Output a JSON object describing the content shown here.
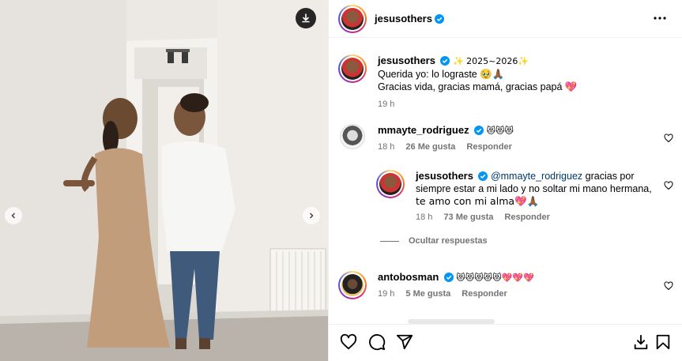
{
  "post": {
    "author": "jesusothers",
    "verified": true
  },
  "caption": {
    "username": "jesusothers",
    "line1": "✨ 2025~2026✨",
    "line2": "Querida yo: lo lograste 🥹🙏🏾",
    "line3": "Gracias vida, gracias mamá, gracias papá 💖",
    "time": "19 h"
  },
  "comments": [
    {
      "username": "mmayte_rodriguez",
      "text": "😻😻😻",
      "time": "18 h",
      "likes": "26 Me gusta",
      "reply_label": "Responder"
    },
    {
      "username": "jesusothers",
      "mention": "@mmayte_rodriguez",
      "text_line1": " gracias por",
      "text_line2": "siempre estar a mi lado y no soltar mi mano hermana,",
      "text_line3": "te amo con mi alma💖🙏🏾",
      "time": "18 h",
      "likes": "73 Me gusta",
      "reply_label": "Responder"
    },
    {
      "username": "antobosman",
      "text": "😻😻😻😻😻💖💖💖",
      "time": "19 h",
      "likes": "5 Me gusta",
      "reply_label": "Responder"
    }
  ],
  "hide_replies_label": "Ocultar respuestas",
  "icons": {
    "download": "download-icon",
    "prev": "chevron-left-icon",
    "next": "chevron-right-icon",
    "more": "more-horizontal-icon",
    "like": "heart-icon",
    "comment": "comment-icon",
    "share": "send-icon",
    "save": "bookmark-icon"
  },
  "colors": {
    "verified": "#0095f6",
    "secondary_text": "#737373",
    "mention": "#00376b"
  }
}
